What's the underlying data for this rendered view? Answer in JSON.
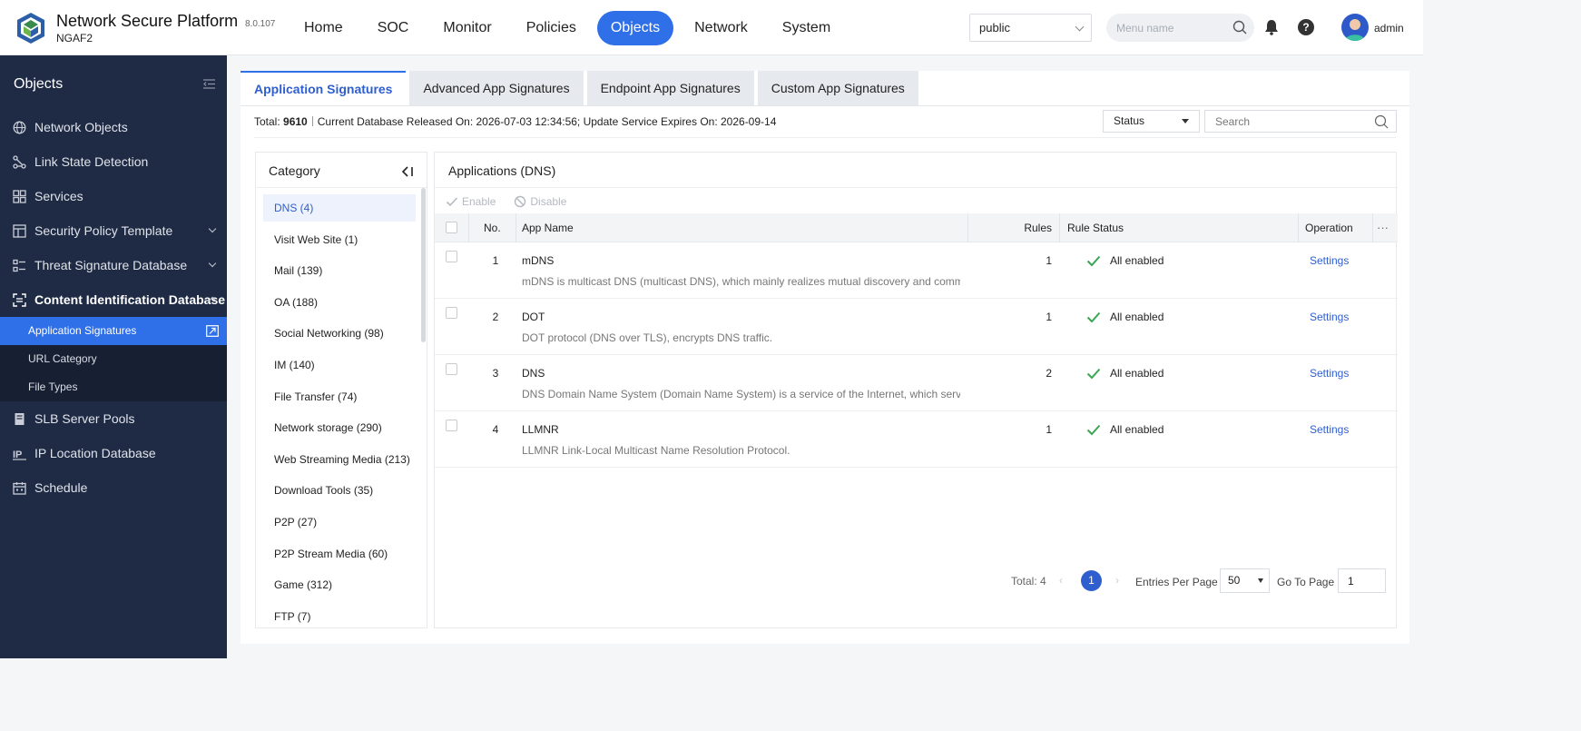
{
  "header": {
    "brand_title": "Network Secure Platform",
    "brand_sub": "NGAF2",
    "version": "8.0.107",
    "nav": [
      {
        "label": "Home",
        "active": false
      },
      {
        "label": "SOC",
        "active": false
      },
      {
        "label": "Monitor",
        "active": false
      },
      {
        "label": "Policies",
        "active": false
      },
      {
        "label": "Objects",
        "active": true
      },
      {
        "label": "Network",
        "active": false
      },
      {
        "label": "System",
        "active": false
      }
    ],
    "tenant": "public",
    "menu_search_placeholder": "Menu name",
    "help_glyph": "?",
    "username": "admin",
    "accent_color": "#2f6fe8"
  },
  "sidebar": {
    "title": "Objects",
    "items": [
      {
        "label": "Network Objects",
        "icon": "globe-icon"
      },
      {
        "label": "Link State Detection",
        "icon": "link-icon"
      },
      {
        "label": "Services",
        "icon": "grid-icon"
      },
      {
        "label": "Security Policy Template",
        "icon": "template-icon",
        "expandable": true
      },
      {
        "label": "Threat Signature Database",
        "icon": "list-icon",
        "expandable": true
      },
      {
        "label": "Content Identification Database",
        "icon": "scan-icon",
        "expandable": true,
        "open": true
      }
    ],
    "sub_items": [
      {
        "label": "Application Signatures",
        "active": true
      },
      {
        "label": "URL Category",
        "active": false
      },
      {
        "label": "File Types",
        "active": false
      }
    ],
    "items_after": [
      {
        "label": "SLB Server Pools",
        "icon": "server-icon"
      },
      {
        "label": "IP Location Database",
        "icon": "ip-icon"
      },
      {
        "label": "Schedule",
        "icon": "calendar-icon"
      }
    ],
    "bg_color": "#1f2a44"
  },
  "main": {
    "tabs": [
      {
        "label": "Application Signatures",
        "active": true
      },
      {
        "label": "Advanced App Signatures",
        "active": false
      },
      {
        "label": "Endpoint App Signatures",
        "active": false
      },
      {
        "label": "Custom App Signatures",
        "active": false
      }
    ],
    "summary": {
      "total_label": "Total:",
      "total": "9610",
      "info": "Current Database Released On: 2026-07-03 12:34:56; Update Service Expires On: 2026-09-14"
    },
    "status_filter": "Status",
    "search_placeholder": "Search",
    "category": {
      "title": "Category",
      "items": [
        "DNS (4)",
        "Visit Web Site (1)",
        "Mail (139)",
        "OA (188)",
        "Social Networking (98)",
        "IM (140)",
        "File Transfer (74)",
        "Network storage (290)",
        "Web Streaming Media (213)",
        "Download Tools (35)",
        "P2P (27)",
        "P2P Stream Media (60)",
        "Game (312)",
        "FTP (7)"
      ],
      "active_index": 0
    },
    "apps": {
      "title": "Applications (DNS)",
      "toolbar": {
        "enable": "Enable",
        "disable": "Disable"
      },
      "columns": {
        "no": "No.",
        "app_name": "App Name",
        "rules": "Rules",
        "rule_status": "Rule Status",
        "operation": "Operation",
        "more": "···"
      },
      "rows": [
        {
          "no": "1",
          "name": "mDNS",
          "desc": "mDNS is multicast DNS (multicast DNS), which mainly realizes mutual discovery and communicati",
          "rules": "1",
          "status": "All enabled",
          "op": "Settings"
        },
        {
          "no": "2",
          "name": "DOT",
          "desc": "DOT protocol (DNS over TLS), encrypts DNS traffic.",
          "rules": "1",
          "status": "All enabled",
          "op": "Settings"
        },
        {
          "no": "3",
          "name": "DNS",
          "desc": "DNS Domain Name System (Domain Name System) is a service of the Internet, which serves as a",
          "rules": "2",
          "status": "All enabled",
          "op": "Settings"
        },
        {
          "no": "4",
          "name": "LLMNR",
          "desc": "LLMNR Link-Local Multicast Name Resolution Protocol.",
          "rules": "1",
          "status": "All enabled",
          "op": "Settings"
        }
      ],
      "pager": {
        "total": "Total: 4",
        "current": "1",
        "entries_label": "Entries Per Page",
        "page_size": "50",
        "go_label": "Go To Page",
        "go_value": "1",
        "prev": "‹",
        "next": "›"
      },
      "status_ok_color": "#3aa655"
    }
  }
}
